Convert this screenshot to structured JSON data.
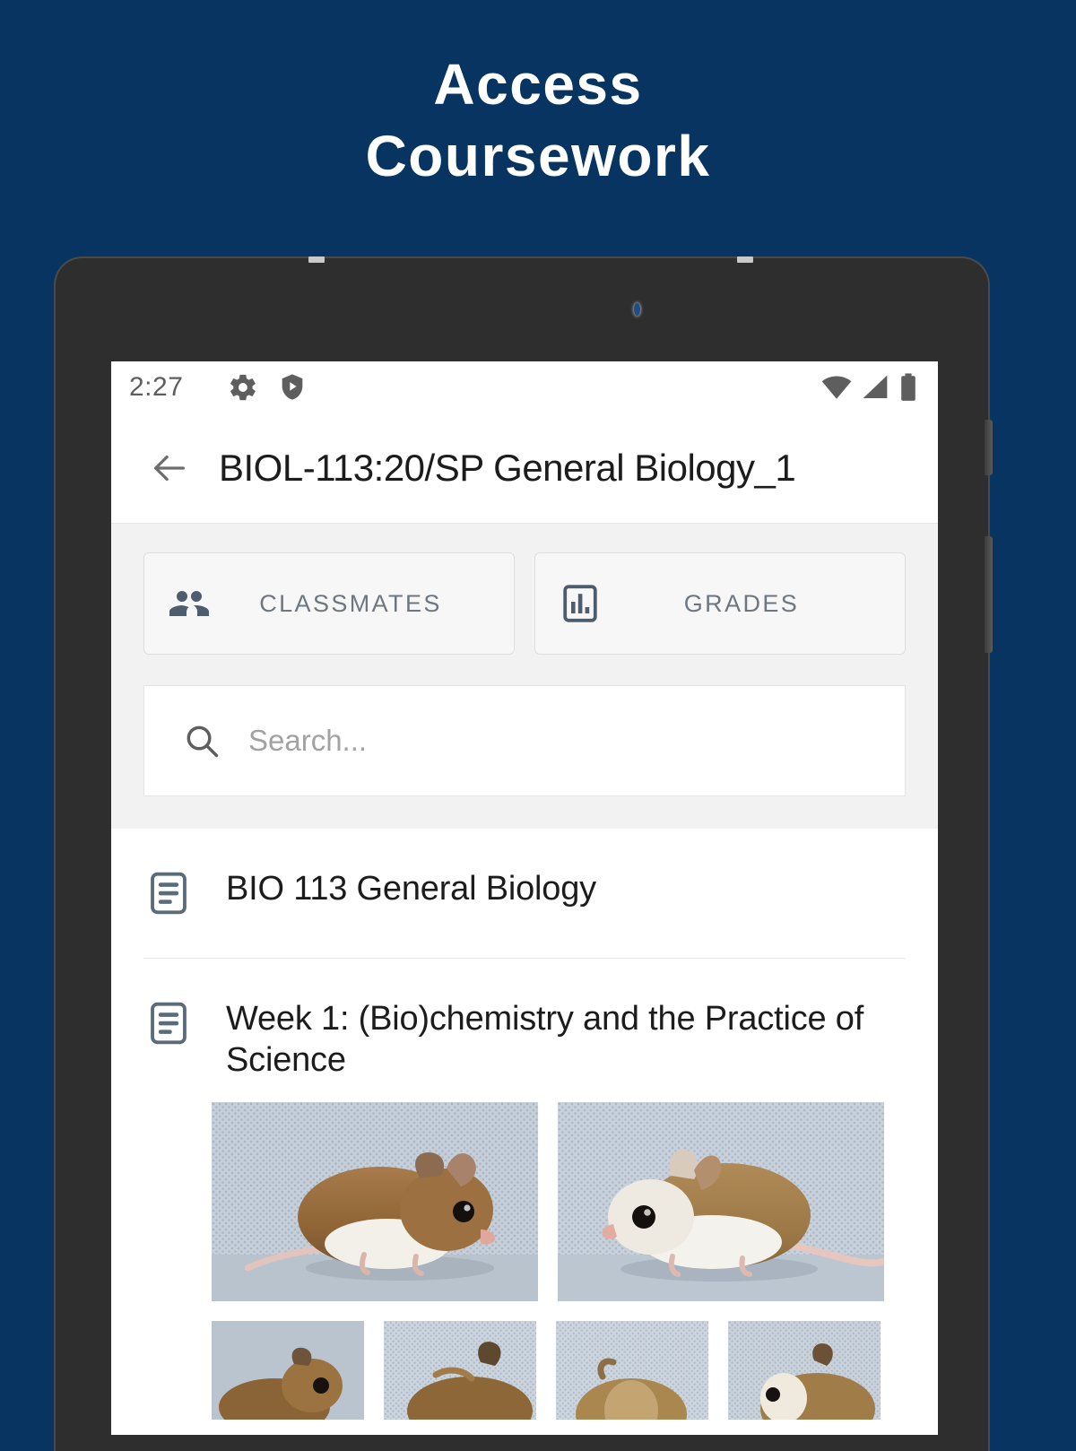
{
  "promo": {
    "headline": "Access\nCoursework",
    "background_color": "#073460"
  },
  "device": {
    "bezel_color": "#2e2e2e",
    "buttons": [
      "power-button",
      "volume-button"
    ]
  },
  "status_bar": {
    "time": "2:27",
    "left_icons": [
      "gear-icon",
      "shield-play-icon"
    ],
    "right_icons": [
      "wifi-icon",
      "cellular-signal-icon",
      "battery-icon"
    ]
  },
  "app_bar": {
    "back_label": "back-arrow",
    "title": "BIOL-113:20/SP General Biology_1"
  },
  "toolbar": {
    "chips": [
      {
        "label": "CLASSMATES",
        "icon": "people-icon"
      },
      {
        "label": "GRADES",
        "icon": "bar-chart-icon"
      }
    ]
  },
  "search": {
    "icon": "search-icon",
    "value": "",
    "placeholder": "Search..."
  },
  "content": {
    "items": [
      {
        "icon": "article-icon",
        "title": "BIO 113 General Biology"
      },
      {
        "icon": "article-icon",
        "title": "Week 1: (Bio)chemistry and the Practice of Science"
      }
    ],
    "photos_row_1": [
      "mouse-photo-1",
      "mouse-photo-2"
    ],
    "photos_row_2": [
      "mouse-photo-3",
      "mouse-photo-4",
      "mouse-photo-5",
      "mouse-photo-6"
    ]
  },
  "colors": {
    "accent": "#073460",
    "panel": "#f2f2f2",
    "chip_text": "#6e7780",
    "body_text": "#1c1c1c",
    "placeholder": "#a2a2a2"
  }
}
